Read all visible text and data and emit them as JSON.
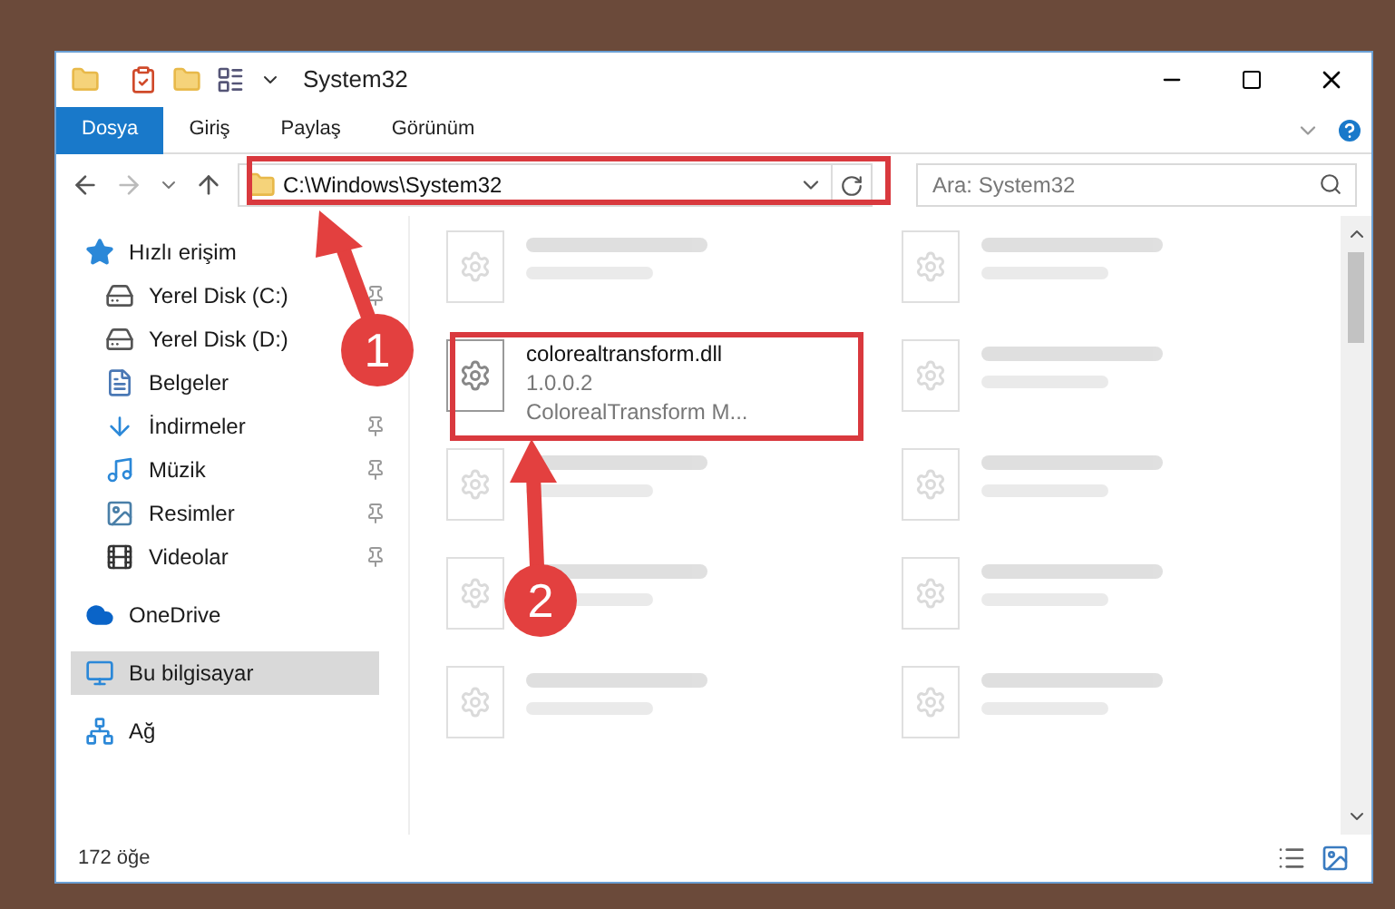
{
  "window": {
    "title": "System32"
  },
  "ribbon": {
    "tabs": [
      {
        "label": "Dosya",
        "selected": true
      },
      {
        "label": "Giriş",
        "selected": false
      },
      {
        "label": "Paylaş",
        "selected": false
      },
      {
        "label": "Görünüm",
        "selected": false
      }
    ]
  },
  "address": {
    "path": "C:\\Windows\\System32"
  },
  "search": {
    "placeholder": "Ara: System32"
  },
  "sidebar": {
    "items": [
      {
        "label": "Hızlı erişim",
        "kind": "star",
        "selected": false,
        "children": [
          {
            "label": "Yerel Disk (C:)",
            "kind": "drive",
            "selected": false,
            "pinned": true
          },
          {
            "label": "Yerel Disk (D:)",
            "kind": "drive",
            "selected": false
          },
          {
            "label": "Belgeler",
            "kind": "document",
            "selected": false
          },
          {
            "label": "İndirmeler",
            "kind": "download",
            "selected": false,
            "pinned": true
          },
          {
            "label": "Müzik",
            "kind": "music",
            "selected": false,
            "pinned": true
          },
          {
            "label": "Resimler",
            "kind": "picture",
            "selected": false,
            "pinned": true
          },
          {
            "label": "Videolar",
            "kind": "video",
            "selected": false,
            "pinned": true
          }
        ]
      },
      {
        "label": "OneDrive",
        "kind": "cloud",
        "selected": false
      },
      {
        "label": "Bu bilgisayar",
        "kind": "computer",
        "selected": true
      },
      {
        "label": "Ağ",
        "kind": "network",
        "selected": false
      }
    ]
  },
  "files": [
    {
      "blurred": true
    },
    {
      "blurred": true
    },
    {
      "name": "colorealtransform.dll",
      "line_2": "1.0.0.2",
      "line_3": "ColorealTransform M...",
      "blurred": false
    },
    {
      "blurred": true
    },
    {
      "blurred": true
    },
    {
      "blurred": true
    },
    {
      "blurred": true
    },
    {
      "blurred": true
    },
    {
      "blurred": true
    },
    {
      "blurred": true
    }
  ],
  "status_bar": {
    "count": "172 öğe"
  },
  "annotations": [
    {
      "number": "1"
    },
    {
      "number": "2"
    }
  ]
}
